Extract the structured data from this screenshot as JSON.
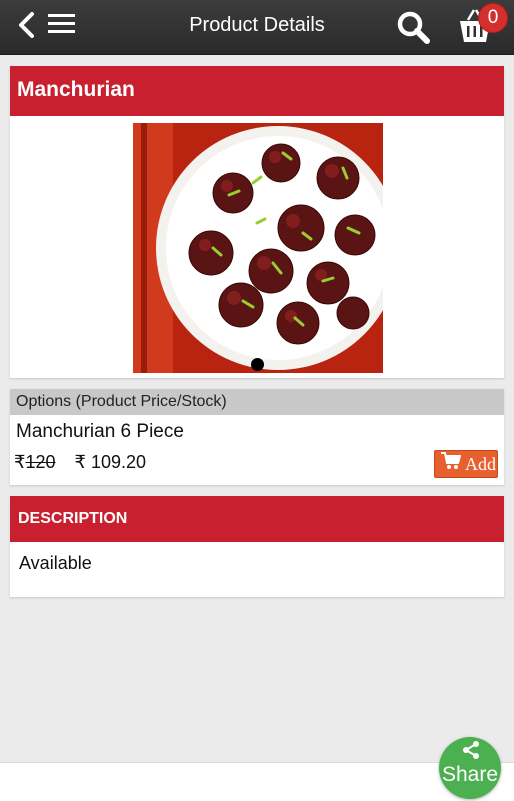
{
  "header": {
    "title": "Product Details",
    "cart_count": "0",
    "icons": [
      "back-arrow-icon",
      "hamburger-menu-icon",
      "search-icon",
      "shopping-basket-icon"
    ]
  },
  "product": {
    "name": "Manchurian",
    "image_alt": "Manchurian balls on a white plate",
    "carousel_dots": 1
  },
  "options": {
    "header": "Options (Product Price/Stock)",
    "item_name": "Manchurian 6 Piece",
    "currency_symbol": "₹",
    "old_price": "120",
    "new_price": "₹ 109.20",
    "add_label": "Add"
  },
  "description": {
    "header": "DESCRIPTION",
    "text": "Available"
  },
  "share": {
    "label": "Share"
  },
  "colors": {
    "topbar": "#2f2f2f",
    "accent_red": "#c9202f",
    "add_button": "#e8602d",
    "share_button": "#4caf50",
    "badge": "#d32f2f"
  }
}
